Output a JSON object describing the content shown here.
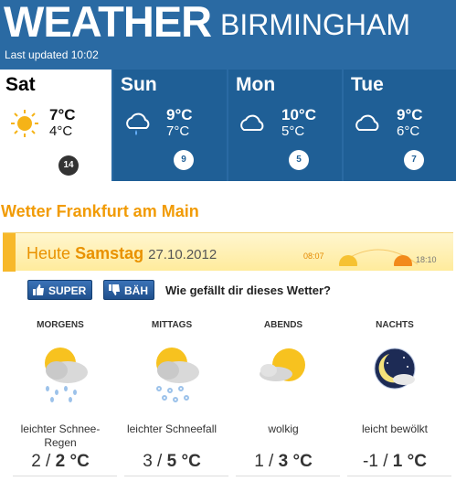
{
  "header": {
    "title": "WEATHER",
    "city": "BIRMINGHAM",
    "updated": "Last updated 10:02"
  },
  "forecast": [
    {
      "day": "Sat",
      "hi": "7°C",
      "lo": "4°C",
      "wind": "14",
      "icon": "sun-icon"
    },
    {
      "day": "Sun",
      "hi": "9°C",
      "lo": "7°C",
      "wind": "9",
      "icon": "rain-cloud-icon"
    },
    {
      "day": "Mon",
      "hi": "10°C",
      "lo": "5°C",
      "wind": "5",
      "icon": "cloud-icon"
    },
    {
      "day": "Tue",
      "hi": "9°C",
      "lo": "6°C",
      "wind": "7",
      "icon": "cloud-icon"
    }
  ],
  "frankfurt": {
    "title": "Wetter Frankfurt am Main",
    "heute": "Heute",
    "day": "Samstag",
    "date": "27.10.2012",
    "sunrise": "08:07",
    "sunset": "18:10",
    "vote_super": "SUPER",
    "vote_bah": "BÄH",
    "vote_question": "Wie gefällt dir dieses Wetter?",
    "periods": [
      {
        "name": "MORGENS",
        "desc": "leichter Schnee-Regen",
        "temps": "2 / 2 °C",
        "low": "2",
        "high": "2 °C",
        "icon": "sleet-icon"
      },
      {
        "name": "MITTAGS",
        "desc": "leichter Schneefall",
        "temps": "3 / 5 °C",
        "low": "3",
        "high": "5 °C",
        "icon": "snow-icon"
      },
      {
        "name": "ABENDS",
        "desc": "wolkig",
        "temps": "1 / 3 °C",
        "low": "1",
        "high": "3 °C",
        "icon": "partly-cloudy-icon"
      },
      {
        "name": "NACHTS",
        "desc": "leicht bewölkt",
        "temps": "-1 / 1 °C",
        "low": "-1",
        "high": "1 °C",
        "icon": "moon-cloud-icon"
      }
    ]
  },
  "colors": {
    "header_blue": "#2a6aa3",
    "accent_orange": "#f19b05"
  }
}
